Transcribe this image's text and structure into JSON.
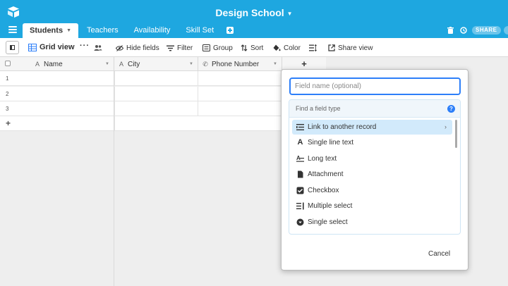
{
  "colors": {
    "accent": "#1ea7e0",
    "selection": "#d2eafb",
    "focus": "#2d7ff9"
  },
  "header": {
    "title": "Design School",
    "share_label": "SHARE"
  },
  "tabs": [
    {
      "label": "Students",
      "active": true
    },
    {
      "label": "Teachers"
    },
    {
      "label": "Availability"
    },
    {
      "label": "Skill Set"
    }
  ],
  "toolbar": {
    "view_name": "Grid view",
    "more": "···",
    "hide_fields": "Hide fields",
    "filter": "Filter",
    "group": "Group",
    "sort": "Sort",
    "color": "Color",
    "share_view": "Share view"
  },
  "grid": {
    "columns": [
      {
        "label": "Name",
        "icon": "text-a-icon"
      },
      {
        "label": "City",
        "icon": "text-a-icon"
      },
      {
        "label": "Phone Number",
        "icon": "phone-icon"
      }
    ],
    "add_column": "+",
    "rows": [
      "1",
      "2",
      "3"
    ],
    "add_row": "+"
  },
  "popup": {
    "field_name_placeholder": "Field name (optional)",
    "search_placeholder": "Find a field type",
    "help": "?",
    "field_types": [
      {
        "label": "Link to another record",
        "icon": "link-record-icon",
        "selected": true
      },
      {
        "label": "Single line text",
        "icon": "text-a-icon"
      },
      {
        "label": "Long text",
        "icon": "long-text-icon"
      },
      {
        "label": "Attachment",
        "icon": "attachment-icon"
      },
      {
        "label": "Checkbox",
        "icon": "checkbox-icon"
      },
      {
        "label": "Multiple select",
        "icon": "multi-select-icon"
      },
      {
        "label": "Single select",
        "icon": "single-select-icon"
      }
    ],
    "cancel": "Cancel"
  }
}
